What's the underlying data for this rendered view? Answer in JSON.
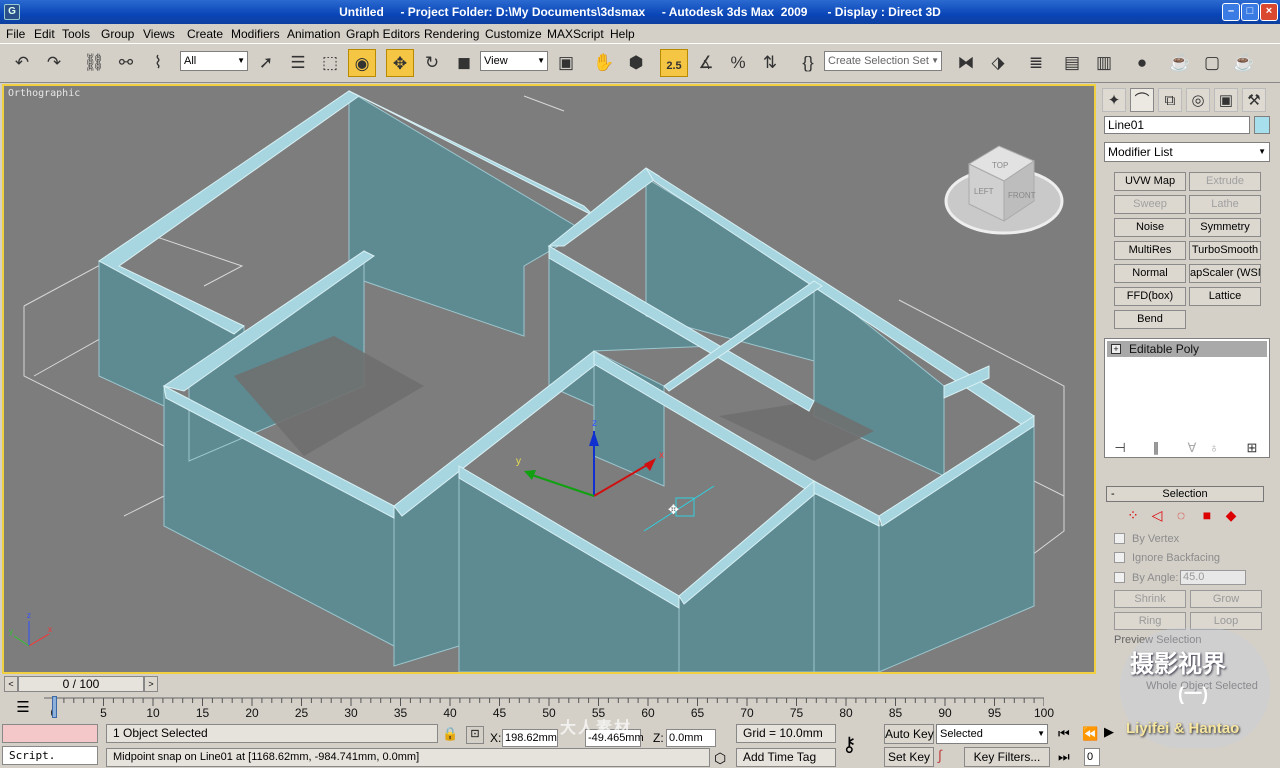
{
  "window": {
    "title": "Untitled     - Project Folder: D:\\My Documents\\3dsmax     - Autodesk 3ds Max  2009      - Display : Direct 3D",
    "app_icon": "G",
    "minimize": "–",
    "maximize": "□",
    "close": "×"
  },
  "menu": [
    "File",
    "Edit",
    "Tools",
    "Group",
    "Views",
    "Create",
    "Modifiers",
    "Animation",
    "Graph Editors",
    "Rendering",
    "Customize",
    "MAXScript",
    "Help"
  ],
  "toolbar": {
    "filter_value": "All",
    "refcoord_value": "View",
    "named_selection_placeholder": "Create Selection Set",
    "angle_snap_label": "2.5"
  },
  "viewport": {
    "label": "Orthographic",
    "gizmo_axes": {
      "x": "x",
      "y": "y",
      "z": "z"
    },
    "viewcube": {
      "top": "TOP",
      "left": "LEFT",
      "front": "FRONT"
    }
  },
  "command_panel": {
    "object_name": "Line01",
    "modifier_list": "Modifier List",
    "modifier_buttons": [
      {
        "label": "UVW Map",
        "enabled": true
      },
      {
        "label": "Extrude",
        "enabled": false
      },
      {
        "label": "Sweep",
        "enabled": false
      },
      {
        "label": "Lathe",
        "enabled": false
      },
      {
        "label": "Noise",
        "enabled": true
      },
      {
        "label": "Symmetry",
        "enabled": true
      },
      {
        "label": "MultiRes",
        "enabled": true
      },
      {
        "label": "TurboSmooth",
        "enabled": true
      },
      {
        "label": "Normal",
        "enabled": true
      },
      {
        "label": "apScaler (WSM",
        "enabled": true
      },
      {
        "label": "FFD(box)",
        "enabled": true
      },
      {
        "label": "Lattice",
        "enabled": true
      },
      {
        "label": "Bend",
        "enabled": true
      }
    ],
    "stack": [
      {
        "label": "Editable Poly",
        "expander": "+"
      }
    ],
    "selection_rollout": {
      "title": "Selection",
      "collapse": "-",
      "by_vertex": "By Vertex",
      "ignore_backfacing": "Ignore Backfacing",
      "by_angle": "By Angle:",
      "angle_value": "45.0",
      "shrink": "Shrink",
      "grow": "Grow",
      "ring": "Ring",
      "loop": "Loop",
      "preview_selection": "Preview Selection",
      "whole_object": "Whole Object Selected"
    }
  },
  "timeline": {
    "frame": "0 / 100",
    "prev": "<",
    "next": ">",
    "ticks": [
      "0",
      "5",
      "10",
      "15",
      "20",
      "25",
      "30",
      "35",
      "40",
      "45",
      "50",
      "55",
      "60",
      "65",
      "70",
      "75",
      "80",
      "85",
      "90",
      "95",
      "100"
    ]
  },
  "statusbar": {
    "script_label": "Script.",
    "selection_status": "1 Object Selected",
    "prompt": "Midpoint snap on Line01 at [1168.62mm, -984.741mm, 0.0mm]",
    "x_label": "X:",
    "x_value": "198.62mm",
    "y_value": "-49.465mm",
    "z_label": "Z:",
    "z_value": "0.0mm",
    "grid": "Grid = 10.0mm",
    "add_time_tag": "Add Time Tag",
    "auto_key": "Auto Key",
    "set_key": "Set Key",
    "key_mode_value": "Selected",
    "key_filters": "Key Filters...",
    "current_frame": "0"
  },
  "watermarks": {
    "brand_cn": "摄影视界",
    "brand_cn_sub": "(一)",
    "brand_en": "Liyifei & Hantao",
    "site_cn": "大人素材"
  },
  "colors": {
    "viewport_bg": "#7d7d7d",
    "wall_fill": "#5e8a92",
    "wall_top": "#a7d6e0",
    "active_border": "#f0d040",
    "titlebar": "#0a46b8"
  }
}
